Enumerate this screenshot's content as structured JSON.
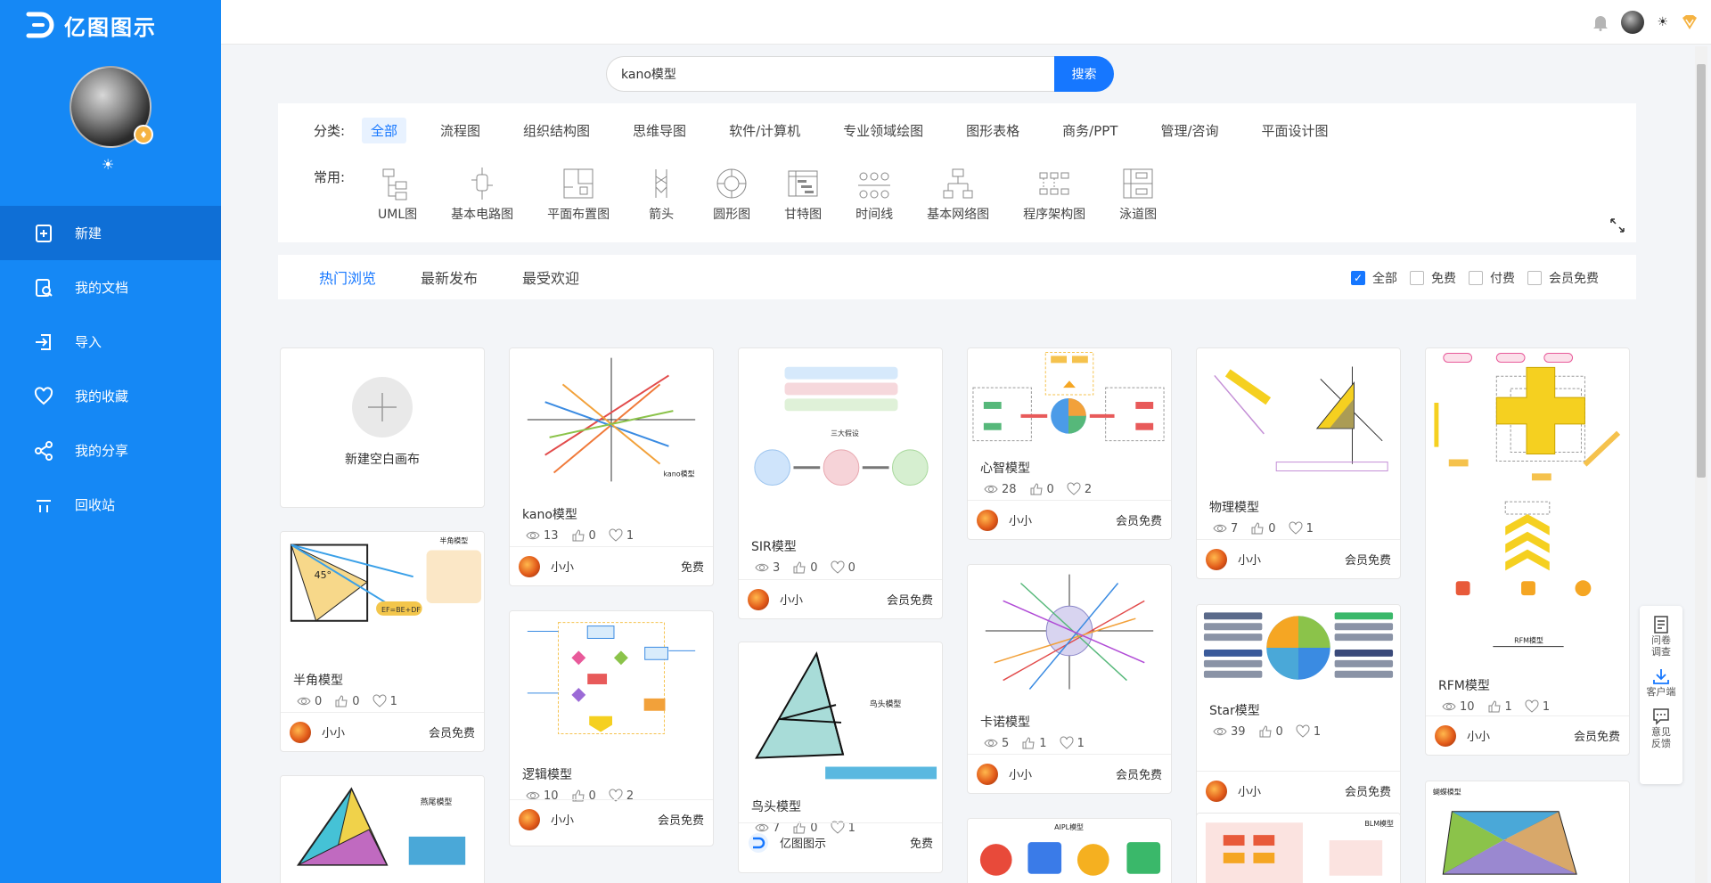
{
  "app": {
    "name": "亿图图示"
  },
  "sidebar": {
    "items": [
      {
        "label": "新建",
        "icon": "new-file-icon"
      },
      {
        "label": "我的文档",
        "icon": "documents-icon"
      },
      {
        "label": "导入",
        "icon": "import-icon"
      },
      {
        "label": "我的收藏",
        "icon": "heart-icon"
      },
      {
        "label": "我的分享",
        "icon": "share-icon"
      },
      {
        "label": "回收站",
        "icon": "trash-icon"
      }
    ]
  },
  "search": {
    "value": "kano模型",
    "button_label": "搜索"
  },
  "categories": {
    "label": "分类:",
    "items": [
      "全部",
      "流程图",
      "组织结构图",
      "思维导图",
      "软件/计算机",
      "专业领域绘图",
      "图形表格",
      "商务/PPT",
      "管理/咨询",
      "平面设计图"
    ],
    "active": "全部"
  },
  "common": {
    "label": "常用:",
    "items": [
      "UML图",
      "基本电路图",
      "平面布置图",
      "箭头",
      "圆形图",
      "甘特图",
      "时间线",
      "基本网络图",
      "程序架构图",
      "泳道图"
    ]
  },
  "tabs": {
    "items": [
      "热门浏览",
      "最新发布",
      "最受欢迎"
    ],
    "active": "热门浏览"
  },
  "filters": [
    {
      "label": "全部",
      "checked": true
    },
    {
      "label": "免费",
      "checked": false
    },
    {
      "label": "付费",
      "checked": false
    },
    {
      "label": "会员免费",
      "checked": false
    }
  ],
  "new_canvas": {
    "label": "新建空白画布"
  },
  "cards": [
    {
      "title": "半角模型",
      "views": "0",
      "likes": "0",
      "favs": "1",
      "author": "小小",
      "price": "会员免费"
    },
    {
      "title": "kano模型",
      "views": "13",
      "likes": "0",
      "favs": "1",
      "author": "小小",
      "price": "免费"
    },
    {
      "title": "逻辑模型",
      "views": "10",
      "likes": "0",
      "favs": "2",
      "author": "小小",
      "price": "会员免费"
    },
    {
      "title": "SIR模型",
      "views": "3",
      "likes": "0",
      "favs": "0",
      "author": "小小",
      "price": "会员免费"
    },
    {
      "title": "鸟头模型",
      "views": "7",
      "likes": "0",
      "favs": "1",
      "author": "亿图图示",
      "price": "免费"
    },
    {
      "title": "心智模型",
      "views": "28",
      "likes": "0",
      "favs": "2",
      "author": "小小",
      "price": "会员免费"
    },
    {
      "title": "卡诺模型",
      "views": "5",
      "likes": "1",
      "favs": "1",
      "author": "小小",
      "price": "会员免费"
    },
    {
      "title": "物理模型",
      "views": "7",
      "likes": "0",
      "favs": "1",
      "author": "小小",
      "price": "会员免费"
    },
    {
      "title": "Star模型",
      "views": "39",
      "likes": "0",
      "favs": "1",
      "author": "小小",
      "price": "会员免费"
    },
    {
      "title": "RFM模型",
      "views": "10",
      "likes": "1",
      "favs": "1",
      "author": "小小",
      "price": "会员免费"
    }
  ],
  "thumb_text": {
    "half_angle": "半角模型",
    "half_angle_eq": "EF=BE+DF",
    "angle_45": "45°",
    "kano": "kano模型",
    "sir_title": "三大假设",
    "bird_head": "鸟头模型",
    "swallow_tail": "燕尾模型",
    "rfm": "RFM模型",
    "butterfly": "蝴蝶模型",
    "aipl": "AIPL模型",
    "blm": "BLM模型"
  },
  "float_bar": [
    {
      "label": "问卷调查",
      "icon": "survey-icon"
    },
    {
      "label": "客户端",
      "icon": "download-icon"
    },
    {
      "label": "意见反馈",
      "icon": "feedback-icon"
    }
  ],
  "colors": {
    "primary": "#1588f5",
    "accent": "#1677ff",
    "vip": "#f5b342"
  }
}
